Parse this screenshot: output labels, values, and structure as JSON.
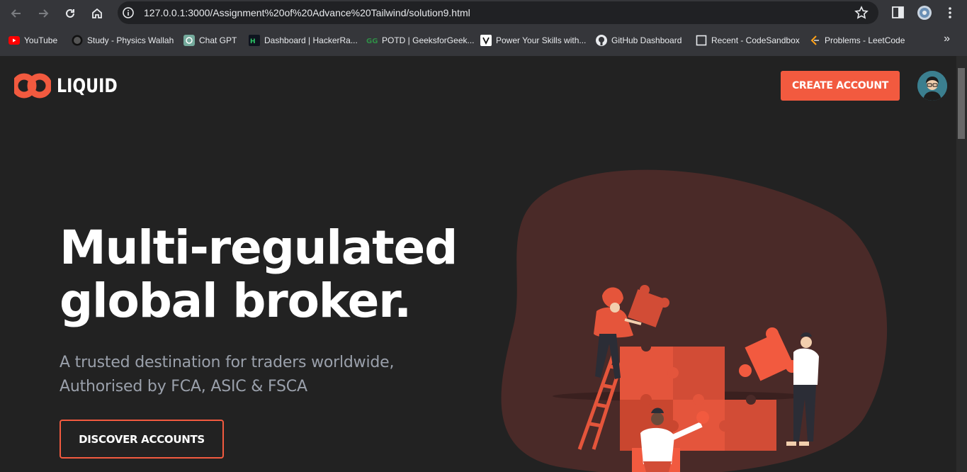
{
  "browser": {
    "url": "127.0.0.1:3000/Assignment%20of%20Advance%20Tailwind/solution9.html",
    "bookmarks": [
      {
        "label": "YouTube",
        "icon": "youtube-icon"
      },
      {
        "label": "Study - Physics Wallah",
        "icon": "physics-wallah-icon"
      },
      {
        "label": "Chat GPT",
        "icon": "chatgpt-icon"
      },
      {
        "label": "Dashboard | HackerRa...",
        "icon": "hackerrank-icon"
      },
      {
        "label": "POTD | GeeksforGeek...",
        "icon": "geeksforgeeks-icon"
      },
      {
        "label": "Power Your Skills with...",
        "icon": "skills-icon"
      },
      {
        "label": "GitHub Dashboard",
        "icon": "github-icon"
      },
      {
        "label": "Recent - CodeSandbox",
        "icon": "codesandbox-icon"
      },
      {
        "label": "Problems - LeetCode",
        "icon": "leetcode-icon"
      }
    ],
    "more_bookmarks": "»"
  },
  "header": {
    "logo_text": "LIQUID",
    "create_account_label": "CREATE ACCOUNT"
  },
  "hero": {
    "title_line1": "Multi-regulated",
    "title_line2": "global broker.",
    "subtitle_line1": "A trusted destination for traders worldwide,",
    "subtitle_line2": "Authorised by FCA, ASIC & FSCA",
    "cta_label": "DISCOVER ACCOUNTS"
  },
  "colors": {
    "accent": "#f25a3f",
    "page_bg": "#222222",
    "blob": "#4a2a28",
    "subtitle": "#9aa0ab"
  }
}
